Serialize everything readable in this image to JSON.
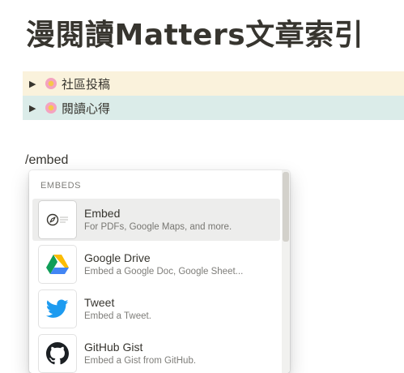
{
  "page": {
    "title": "漫閱讀Matters文章索引"
  },
  "toggles": [
    {
      "label": "社區投稿",
      "icon": "cherry-blossom",
      "background": "#faf2dc"
    },
    {
      "label": "閱讀心得",
      "icon": "cherry-blossom",
      "background": "#dbece9"
    }
  ],
  "command": "/embed",
  "menu": {
    "header": "EMBEDS",
    "items": [
      {
        "name": "Embed",
        "desc": "For PDFs, Google Maps, and more.",
        "icon": "compass-icon",
        "selected": true
      },
      {
        "name": "Google Drive",
        "desc": "Embed a Google Doc, Google Sheet...",
        "icon": "google-drive-icon"
      },
      {
        "name": "Tweet",
        "desc": "Embed a Tweet.",
        "icon": "twitter-bird-icon"
      },
      {
        "name": "GitHub Gist",
        "desc": "Embed a Gist from GitHub.",
        "icon": "github-icon"
      }
    ]
  },
  "colors": {
    "text": "#37352f",
    "selected_bg": "#ededec",
    "twitter_blue": "#1d9bf0"
  }
}
